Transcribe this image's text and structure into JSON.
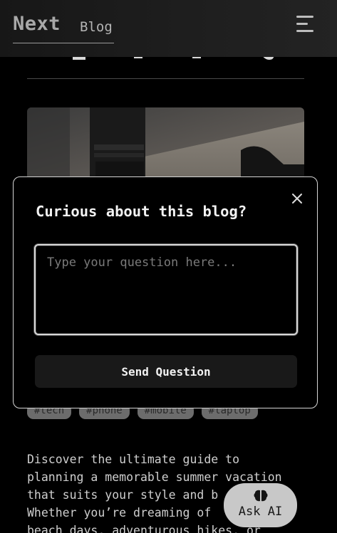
{
  "header": {
    "brand_name": "Next",
    "brand_sub": "Blog"
  },
  "modal": {
    "title": "Curious about this blog?",
    "input_placeholder": "Type your question here...",
    "send_label": "Send Question"
  },
  "article": {
    "tags": [
      "#tech",
      "#phone",
      "#mobile",
      "#laptop"
    ],
    "excerpt_lines": [
      "Discover the ultimate guide to",
      "planning a memorable summer vacation",
      "that suits your style and b",
      "Whether you’re dreaming of",
      "beach days, adventurous hikes, or"
    ]
  },
  "ask_ai": {
    "label": "Ask AI"
  }
}
